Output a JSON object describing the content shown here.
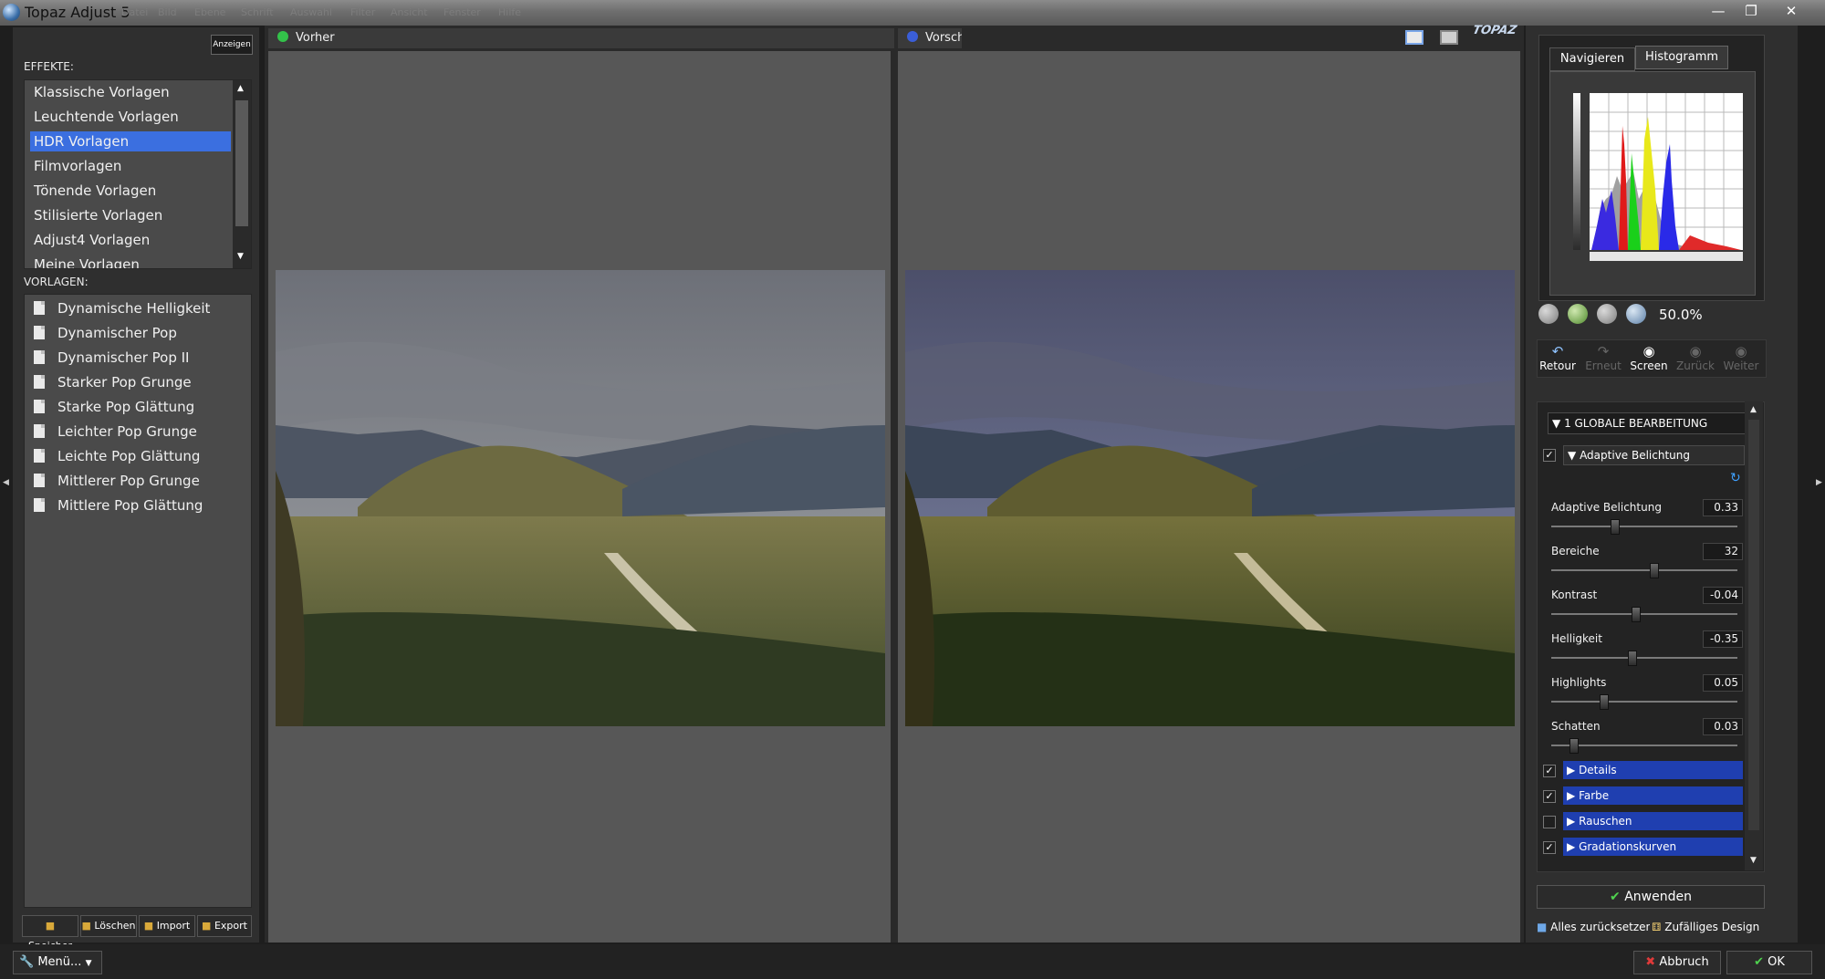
{
  "window": {
    "title": "Topaz Adjust 5",
    "menu": [
      "Datei",
      "Bild",
      "Ebene",
      "Schrift",
      "Auswahl",
      "Filter",
      "Ansicht",
      "Fenster",
      "Hilfe"
    ]
  },
  "left": {
    "show_button": "Anzeigen",
    "effects_label": "EFFEKTE:",
    "effects": [
      "Klassische Vorlagen",
      "Leuchtende Vorlagen",
      "HDR Vorlagen",
      "Filmvorlagen",
      "Tönende Vorlagen",
      "Stilisierte Vorlagen",
      "Adjust4 Vorlagen",
      "Meine Vorlagen"
    ],
    "selected_effect": "HDR Vorlagen",
    "presets_label": "VORLAGEN:",
    "presets": [
      "Dynamische Helligkeit",
      "Dynamischer Pop",
      "Dynamischer Pop II",
      "Starker Pop Grunge",
      "Starke Pop Glättung",
      "Leichter Pop Grunge",
      "Leichte Pop Glättung",
      "Mittlerer Pop Grunge",
      "Mittlere Pop Glättung"
    ],
    "buttons": [
      "Speicher",
      "Löschen",
      "Import",
      "Export"
    ]
  },
  "center": {
    "before_label": "Vorher",
    "preview_label": "Vorschau",
    "logo": "TOPAZ"
  },
  "right": {
    "tabs": [
      "Navigieren",
      "Histogramm"
    ],
    "active_tab": "Histogramm",
    "zoom": "50.0%",
    "tools": [
      "Retour",
      "Erneut",
      "Screen",
      "Zurück",
      "Weiter"
    ],
    "section_title": "1 GLOBALE BEARBEITUNG",
    "subsection": "Adaptive Belichtung",
    "sliders": [
      {
        "label": "Adaptive Belichtung",
        "value": "0.33",
        "pos": 0.33
      },
      {
        "label": "Bereiche",
        "value": "32",
        "pos": 0.55
      },
      {
        "label": "Kontrast",
        "value": "-0.04",
        "pos": 0.45
      },
      {
        "label": "Helligkeit",
        "value": "-0.35",
        "pos": 0.43
      },
      {
        "label": "Highlights",
        "value": "0.05",
        "pos": 0.27
      },
      {
        "label": "Schatten",
        "value": "0.03",
        "pos": 0.1
      }
    ],
    "groups": [
      {
        "label": "Details",
        "checked": true
      },
      {
        "label": "Farbe",
        "checked": true
      },
      {
        "label": "Rauschen",
        "checked": false
      },
      {
        "label": "Gradationskurven",
        "checked": true
      }
    ],
    "apply": "Anwenden",
    "reset_all": "Alles zurücksetzen",
    "random_design": "Zufälliges Design"
  },
  "status": {
    "menu": "Menü...",
    "cancel": "Abbruch",
    "ok": "OK"
  },
  "colors": {
    "selection": "#3b6fe0",
    "group_header": "#1f3fb0",
    "before_dot": "#33c24a",
    "preview_dot": "#3a5ed8"
  }
}
